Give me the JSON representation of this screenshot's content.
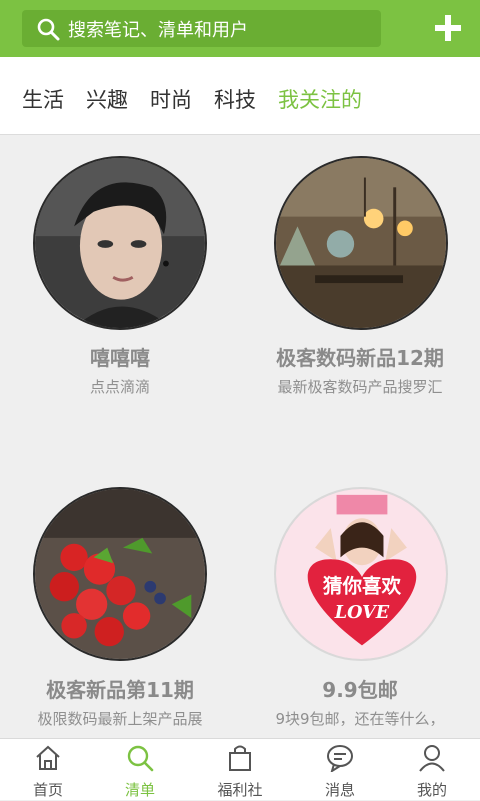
{
  "search": {
    "placeholder": "搜索笔记、清单和用户"
  },
  "tabs": [
    {
      "label": "生活"
    },
    {
      "label": "兴趣"
    },
    {
      "label": "时尚"
    },
    {
      "label": "科技"
    },
    {
      "label": "我关注的",
      "active": true
    }
  ],
  "cards": [
    {
      "title": "嘻嘻嘻",
      "subtitle": "点点滴滴",
      "image": "portrait-man"
    },
    {
      "title": "极客数码新品12期",
      "subtitle": "最新极客数码产品搜罗汇",
      "image": "workshop-lamps"
    },
    {
      "title": "极客新品第11期",
      "subtitle": "极限数码最新上架产品展",
      "image": "strawberries"
    },
    {
      "title": "9.9包邮",
      "subtitle": "9块9包邮，还在等什么，",
      "image": "guess-you-like-love",
      "image_text": "猜你喜欢",
      "image_text2": "LOVE"
    }
  ],
  "bottom_nav": [
    {
      "label": "首页",
      "icon": "home-icon"
    },
    {
      "label": "清单",
      "icon": "search-icon",
      "active": true
    },
    {
      "label": "福利社",
      "icon": "shopping-bag-icon"
    },
    {
      "label": "消息",
      "icon": "chat-icon"
    },
    {
      "label": "我的",
      "icon": "user-icon"
    }
  ],
  "colors": {
    "accent": "#7cc242",
    "accent_dark": "#6aae33",
    "text": "#333333",
    "muted": "#8a8a8a"
  }
}
